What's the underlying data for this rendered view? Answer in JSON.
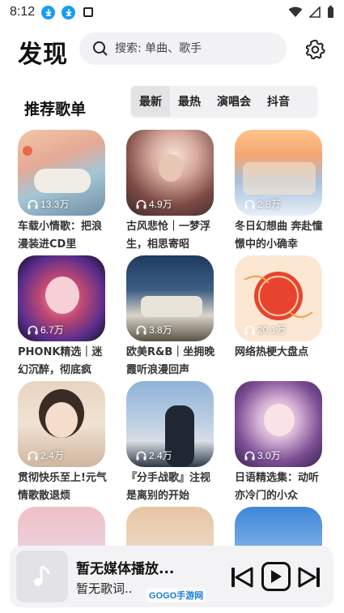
{
  "status_bar": {
    "time": "8:12"
  },
  "header": {
    "title": "发现",
    "search_placeholder": "搜索: 单曲、歌手"
  },
  "section": {
    "title": "推荐歌单",
    "tabs": [
      {
        "label": "最新",
        "active": true
      },
      {
        "label": "最热",
        "active": false
      },
      {
        "label": "演唱会",
        "active": false
      },
      {
        "label": "抖音",
        "active": false
      }
    ]
  },
  "playlists": [
    {
      "plays": "13.3万",
      "title": "车载小情歌：把浪漫装进CD里"
    },
    {
      "plays": "4.9万",
      "title": "古风悲怆｜一梦浮生，相思寄昭"
    },
    {
      "plays": "2.8万",
      "title": "冬日幻想曲 奔赴憧憬中的小确幸"
    },
    {
      "plays": "6.7万",
      "title": "PHONK精选｜迷幻沉醉，彻底疯"
    },
    {
      "plays": "3.8万",
      "title": "欧美R&B｜坐拥晚霞听浪漫回声"
    },
    {
      "plays": "20.1万",
      "title": "网络热梗大盘点"
    },
    {
      "plays": "2.4万",
      "title": "贯彻快乐至上!元气情歌散退烦"
    },
    {
      "plays": "2.4万",
      "title": "『分手战歌』注视是离别的开始"
    },
    {
      "plays": "3.0万",
      "title": "日语精选集：动听亦冷门的小众"
    },
    {
      "plays": "",
      "title": ""
    },
    {
      "plays": "",
      "title": ""
    },
    {
      "plays": "",
      "title": ""
    }
  ],
  "player": {
    "title": "暂无媒体播放...",
    "lyric": "暂无歌词..",
    "watermark": "GOGO手游网"
  },
  "colors": {
    "accent": "#1a9bf0",
    "background": "#ffffff",
    "panel": "#f3f3f5"
  }
}
